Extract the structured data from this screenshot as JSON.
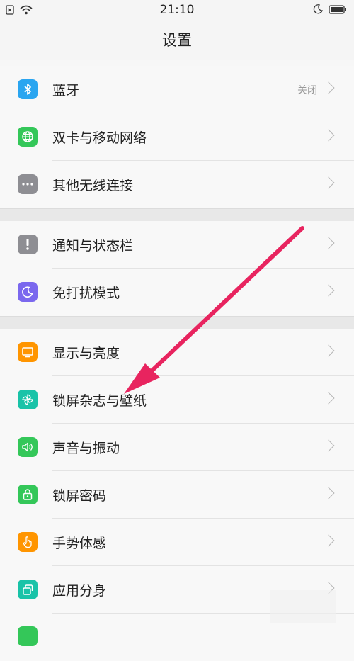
{
  "status_bar": {
    "time": "21:10",
    "icons": [
      "sim-icon",
      "wifi-icon",
      "moon-icon",
      "battery-icon"
    ]
  },
  "header": {
    "title": "设置"
  },
  "groups": [
    {
      "items": [
        {
          "label": "蓝牙",
          "value": "关闭",
          "icon": "bluetooth-icon",
          "color": "#2aa5f0"
        },
        {
          "label": "双卡与移动网络",
          "icon": "globe-icon",
          "color": "#34c759"
        },
        {
          "label": "其他无线连接",
          "icon": "more-icon",
          "color": "#8e8e93"
        }
      ]
    },
    {
      "items": [
        {
          "label": "通知与状态栏",
          "icon": "notification-icon",
          "color": "#8e8e93"
        },
        {
          "label": "免打扰模式",
          "icon": "moon-icon",
          "color": "#7b68ee"
        }
      ]
    },
    {
      "items": [
        {
          "label": "显示与亮度",
          "icon": "display-icon",
          "color": "#ff9500"
        },
        {
          "label": "锁屏杂志与壁纸",
          "icon": "pinwheel-icon",
          "color": "#19c3a8"
        },
        {
          "label": "声音与振动",
          "icon": "speaker-icon",
          "color": "#34c759"
        },
        {
          "label": "锁屏密码",
          "icon": "lock-icon",
          "color": "#34c759"
        },
        {
          "label": "手势体感",
          "icon": "hand-icon",
          "color": "#ff9500"
        },
        {
          "label": "应用分身",
          "icon": "clone-icon",
          "color": "#19c3a8"
        }
      ]
    }
  ],
  "annotation": {
    "type": "arrow",
    "color": "#e8245f",
    "points_to": "锁屏杂志与壁纸"
  }
}
